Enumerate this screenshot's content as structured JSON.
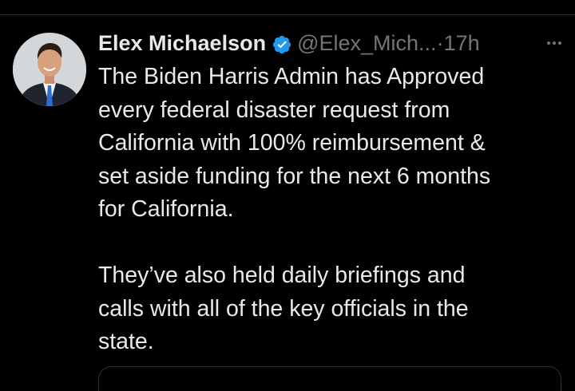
{
  "tweet": {
    "display_name": "Elex Michaelson",
    "handle": "@Elex_Mich...",
    "separator": "·",
    "timestamp": "17h",
    "verified_icon": "verified-badge-icon",
    "avatar_icon": "profile-photo",
    "more_icon": "more-options-icon",
    "paragraph_1_lines": [
      "The Biden Harris Admin has Approved",
      "every federal disaster request from",
      "California with 100% reimbursement &",
      "set aside funding for the next 6 months",
      "for California."
    ],
    "paragraph_2_lines": [
      "They’ve also held daily briefings and",
      "calls with all of the key officials in the",
      "state."
    ]
  },
  "colors": {
    "background": "#000000",
    "primary_text": "#e7e9ea",
    "secondary_text": "#71767b",
    "verified_blue": "#1d9bf0",
    "divider": "#2f3336"
  }
}
